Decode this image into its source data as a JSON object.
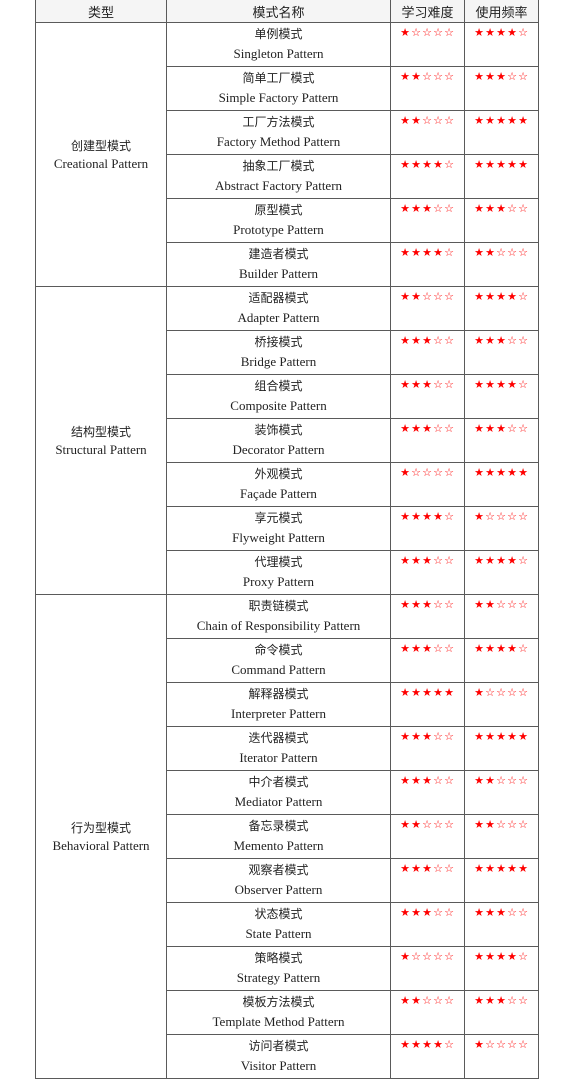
{
  "header": {
    "type": "类型",
    "name": "模式名称",
    "difficulty": "学习难度",
    "frequency": "使用频率"
  },
  "groups": [
    {
      "zh": "创建型模式",
      "en": "Creational Pattern",
      "patterns": [
        {
          "zh": "单例模式",
          "en": "Singleton Pattern",
          "difficulty": 1,
          "frequency": 4
        },
        {
          "zh": "简单工厂模式",
          "en": "Simple Factory Pattern",
          "difficulty": 2,
          "frequency": 3
        },
        {
          "zh": "工厂方法模式",
          "en": "Factory Method Pattern",
          "difficulty": 2,
          "frequency": 5
        },
        {
          "zh": "抽象工厂模式",
          "en": "Abstract  Factory Pattern",
          "difficulty": 4,
          "frequency": 5
        },
        {
          "zh": "原型模式",
          "en": "Prototype Pattern",
          "difficulty": 3,
          "frequency": 3
        },
        {
          "zh": "建造者模式",
          "en": "Builder Pattern",
          "difficulty": 4,
          "frequency": 2
        }
      ]
    },
    {
      "zh": "结构型模式",
      "en": "Structural Pattern",
      "patterns": [
        {
          "zh": "适配器模式",
          "en": "Adapter Pattern",
          "difficulty": 2,
          "frequency": 4
        },
        {
          "zh": "桥接模式",
          "en": "Bridge  Pattern",
          "difficulty": 3,
          "frequency": 3
        },
        {
          "zh": "组合模式",
          "en": "Composite  Pattern",
          "difficulty": 3,
          "frequency": 4
        },
        {
          "zh": "装饰模式",
          "en": "Decorator  Pattern",
          "difficulty": 3,
          "frequency": 3
        },
        {
          "zh": "外观模式",
          "en": "Façade  Pattern",
          "difficulty": 1,
          "frequency": 5
        },
        {
          "zh": "享元模式",
          "en": "Flyweight  Pattern",
          "difficulty": 4,
          "frequency": 1
        },
        {
          "zh": "代理模式",
          "en": "Proxy  Pattern",
          "difficulty": 3,
          "frequency": 4
        }
      ]
    },
    {
      "zh": "行为型模式",
      "en": "Behavioral Pattern",
      "patterns": [
        {
          "zh": "职责链模式",
          "en": "Chain  of Responsibility Pattern",
          "difficulty": 3,
          "frequency": 2
        },
        {
          "zh": "命令模式",
          "en": "Command  Pattern",
          "difficulty": 3,
          "frequency": 4
        },
        {
          "zh": "解释器模式",
          "en": "Interpreter  Pattern",
          "difficulty": 5,
          "frequency": 1
        },
        {
          "zh": "迭代器模式",
          "en": "Iterator  Pattern",
          "difficulty": 3,
          "frequency": 5
        },
        {
          "zh": "中介者模式",
          "en": "Mediator  Pattern",
          "difficulty": 3,
          "frequency": 2
        },
        {
          "zh": "备忘录模式",
          "en": "Memento  Pattern",
          "difficulty": 2,
          "frequency": 2
        },
        {
          "zh": "观察者模式",
          "en": "Observer  Pattern",
          "difficulty": 3,
          "frequency": 5
        },
        {
          "zh": "状态模式",
          "en": "State  Pattern",
          "difficulty": 3,
          "frequency": 3
        },
        {
          "zh": "策略模式",
          "en": "Strategy  Pattern",
          "difficulty": 1,
          "frequency": 4
        },
        {
          "zh": "模板方法模式",
          "en": "Template  Method Pattern",
          "difficulty": 2,
          "frequency": 3
        },
        {
          "zh": "访问者模式",
          "en": "Visitor  Pattern",
          "difficulty": 4,
          "frequency": 1
        }
      ]
    }
  ],
  "rating_max": 5,
  "colors": {
    "star": "#ff0000",
    "border": "#5a5a5a",
    "header_bg": "#f5f5f5"
  }
}
